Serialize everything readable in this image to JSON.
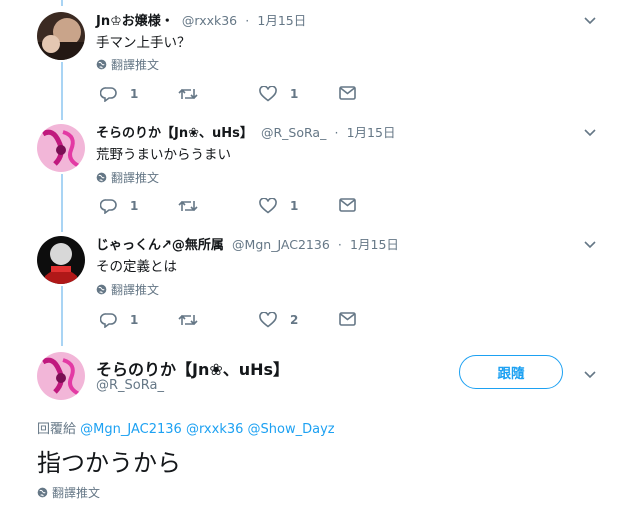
{
  "colors": {
    "accent": "#1da1f2",
    "muted": "#657786",
    "thread": "#a9d4f4"
  },
  "tweets": [
    {
      "name": "Jn♔お嬢様・",
      "handle": "@rxxk36",
      "sep": "·",
      "date": "1月15日",
      "text": "手マン上手い？",
      "translate": "翻譯推文",
      "reply_count": "1",
      "retweet_count": "",
      "like_count": "1"
    },
    {
      "name": "そらのりか【Jn❀、uHs】",
      "handle": "@R_SoRa_",
      "sep": "·",
      "date": "1月15日",
      "text": "荒野うまいからうまい",
      "translate": "翻譯推文",
      "reply_count": "1",
      "retweet_count": "",
      "like_count": "1"
    },
    {
      "name": "じゃっくん↗@無所属",
      "handle": "@Mgn_JAC2136",
      "sep": "·",
      "date": "1月15日",
      "text": "その定義とは",
      "translate": "翻譯推文",
      "reply_count": "1",
      "retweet_count": "",
      "like_count": "2"
    }
  ],
  "main": {
    "name": "そらのりか【Jn❀、uHs】",
    "handle": "@R_SoRa_",
    "follow_label": "跟隨",
    "reply_prefix": "回覆給",
    "mentions": [
      "@Mgn_JAC2136",
      "@rxxk36",
      "@Show_Dayz"
    ],
    "text": "指つかうから",
    "translate": "翻譯推文"
  },
  "icons": {
    "reply": "reply-icon",
    "retweet": "retweet-icon",
    "like": "heart-icon",
    "dm": "envelope-icon",
    "globe": "globe-icon",
    "caret": "chevron-down-icon"
  }
}
